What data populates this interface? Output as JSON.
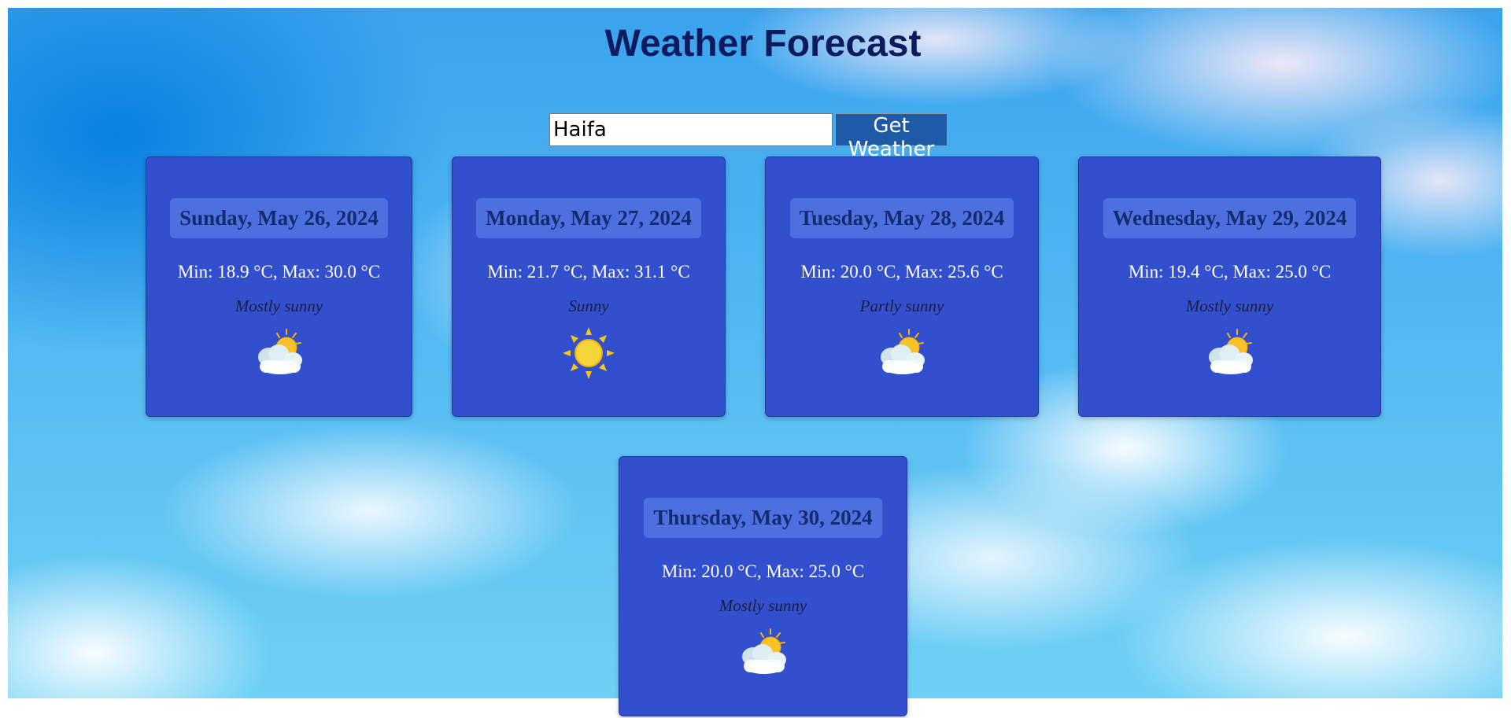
{
  "page": {
    "title": "Weather Forecast"
  },
  "search": {
    "value": "Haifa",
    "button_label": "Get Weather"
  },
  "forecast": [
    {
      "date": "Sunday, May 26, 2024",
      "temps": "Min: 18.9 °C, Max: 30.0 °C",
      "description": "Mostly sunny",
      "icon": "partly-cloudy-icon"
    },
    {
      "date": "Monday, May 27, 2024",
      "temps": "Min: 21.7 °C, Max: 31.1 °C",
      "description": "Sunny",
      "icon": "sun-icon"
    },
    {
      "date": "Tuesday, May 28, 2024",
      "temps": "Min: 20.0 °C, Max: 25.6 °C",
      "description": "Partly sunny",
      "icon": "partly-cloudy-icon"
    },
    {
      "date": "Wednesday, May 29, 2024",
      "temps": "Min: 19.4 °C, Max: 25.0 °C",
      "description": "Mostly sunny",
      "icon": "partly-cloudy-icon"
    },
    {
      "date": "Thursday, May 30, 2024",
      "temps": "Min: 20.0 °C, Max: 25.0 °C",
      "description": "Mostly sunny",
      "icon": "partly-cloudy-icon"
    }
  ],
  "colors": {
    "title": "#0d1a5e",
    "card_background": "#324fce",
    "date_badge": "#4e6fe0",
    "date_text": "#112d6e",
    "button_background": "#1f5aa6"
  }
}
